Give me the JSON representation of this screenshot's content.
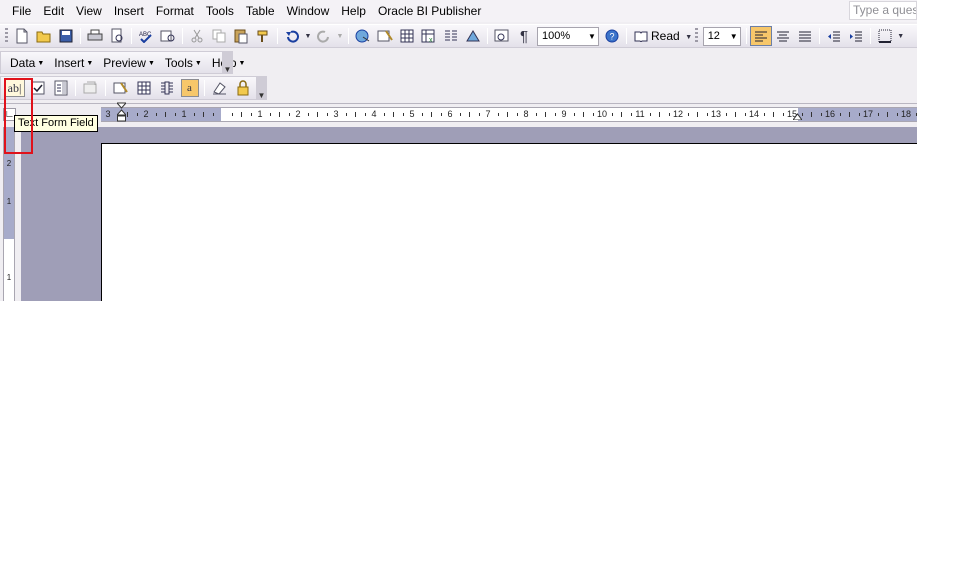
{
  "menubar": {
    "items": [
      "File",
      "Edit",
      "View",
      "Insert",
      "Format",
      "Tools",
      "Table",
      "Window",
      "Help",
      "Oracle BI Publisher"
    ],
    "ask_placeholder": "Type a quest"
  },
  "standard_toolbar": {
    "zoom": "100%",
    "read_label": "Read",
    "font_size": "12"
  },
  "bip_toolbar": {
    "menus": [
      "Data",
      "Insert",
      "Preview",
      "Tools",
      "Help"
    ]
  },
  "forms_toolbar": {
    "text_field_glyph": "ab|"
  },
  "tooltip": "Text Form Field",
  "ruler": {
    "numbers": [
      "3",
      "2",
      "1",
      "",
      "1",
      "2",
      "3",
      "4",
      "5",
      "6",
      "7",
      "8",
      "9",
      "10",
      "11",
      "12",
      "13",
      "14",
      "15",
      "16",
      "17",
      "18"
    ]
  },
  "vertical_ruler": {
    "numbers": [
      "2",
      "1",
      "1"
    ]
  },
  "colors": {
    "highlight": "#e0121b",
    "doc_background": "#9f9eb7",
    "tooltip_bg": "#ffffe1"
  }
}
